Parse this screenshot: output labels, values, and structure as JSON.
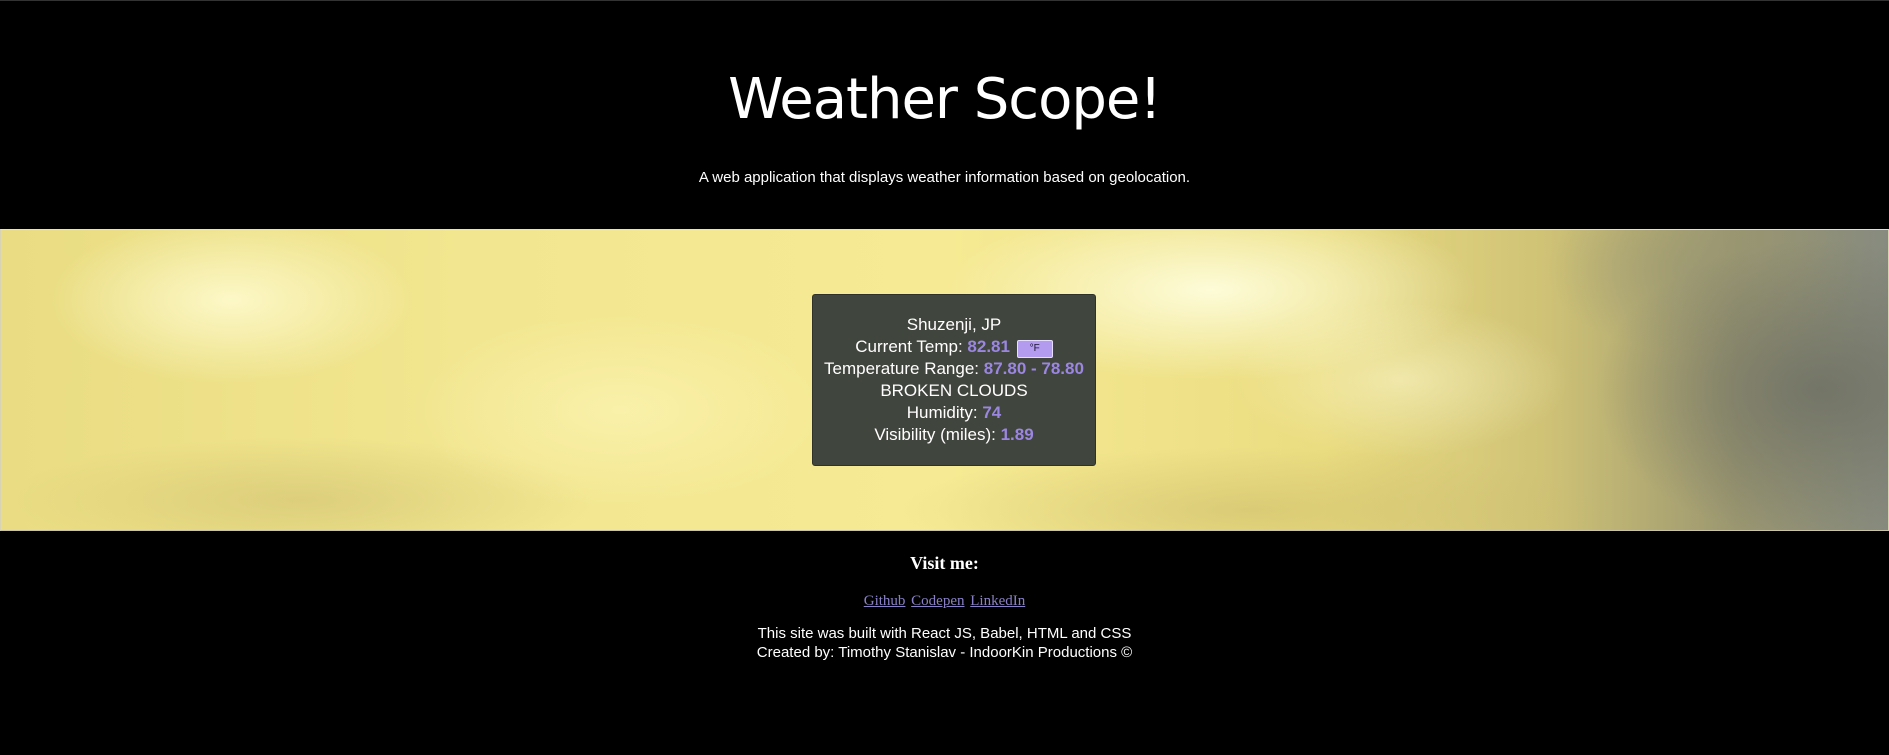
{
  "header": {
    "title": "Weather Scope!",
    "subtitle": "A web application that displays weather information based on geolocation."
  },
  "weather": {
    "location": "Shuzenji, JP",
    "current_temp_label": "Current Temp:",
    "current_temp_value": "82.81",
    "unit_toggle_label": "°F",
    "range_label": "Temperature Range:",
    "range_value": "87.80 - 78.80",
    "condition": "BROKEN CLOUDS",
    "humidity_label": "Humidity:",
    "humidity_value": "74",
    "visibility_label": "Visibility (miles):",
    "visibility_value": "1.89"
  },
  "footer": {
    "visit_heading": "Visit me:",
    "links": [
      "Github",
      "Codepen",
      "LinkedIn"
    ],
    "built_with": "This site was built with React JS, Babel, HTML and CSS",
    "created_by": "Created by: Timothy Stanislav - IndoorKin Productions ©"
  },
  "colors": {
    "background": "#000000",
    "card_background": "#40453d",
    "value_accent": "#9b86e0",
    "link": "#8a80c8",
    "toggle": "#b39cf0"
  }
}
